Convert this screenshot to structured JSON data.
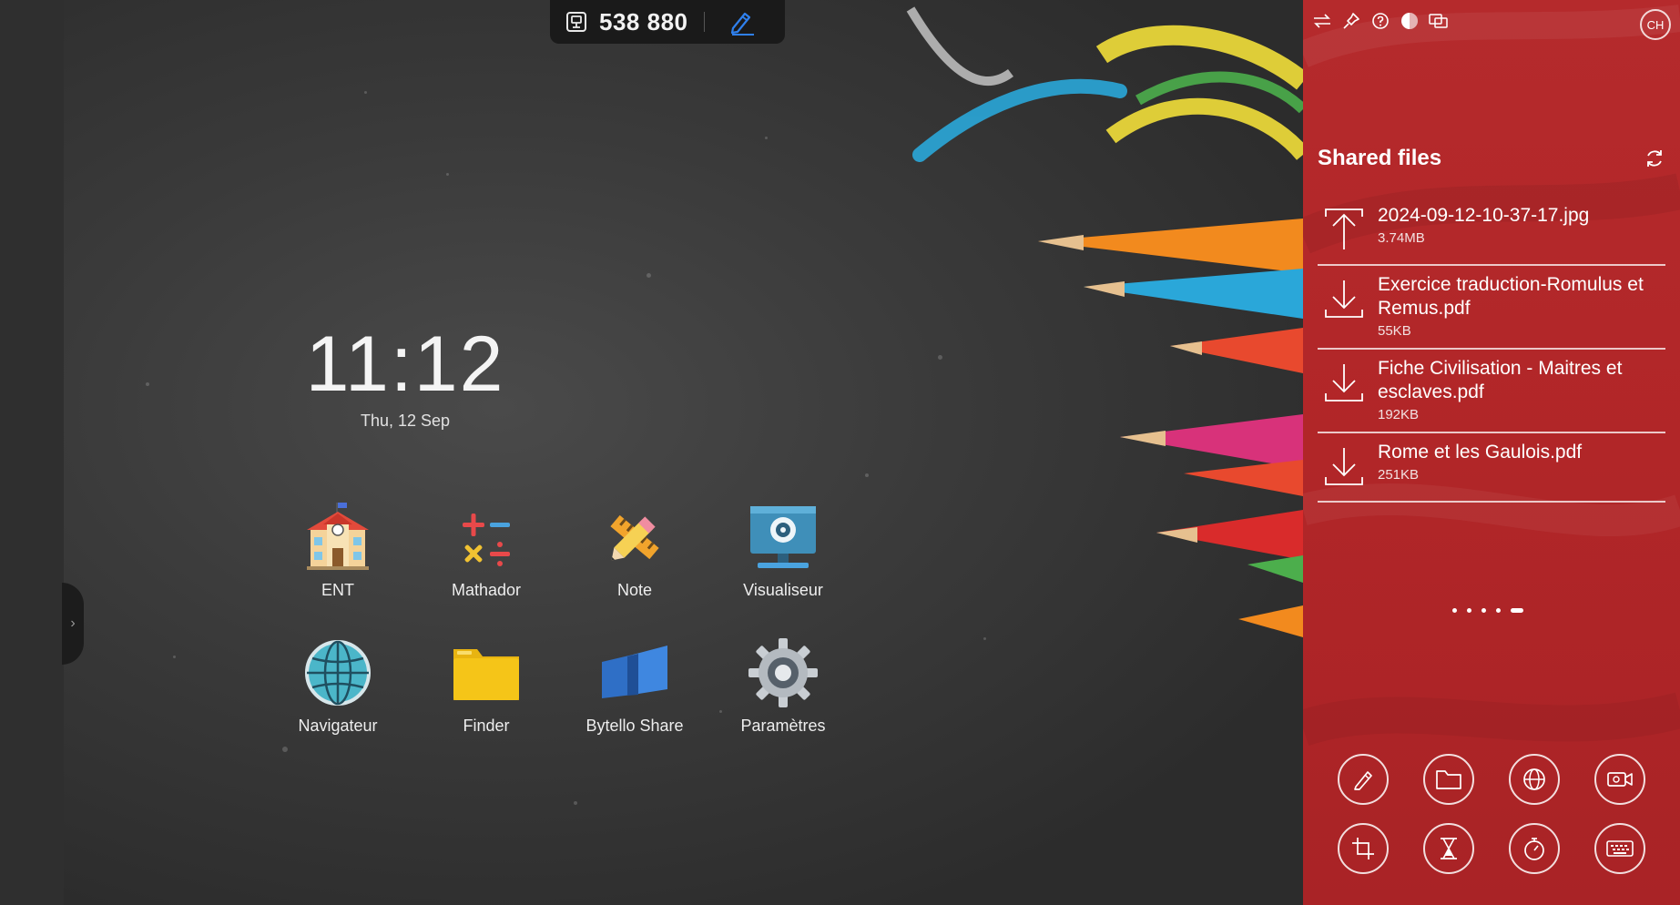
{
  "meeting": {
    "code": "538 880"
  },
  "clock": {
    "time": "11:12",
    "date": "Thu, 12 Sep"
  },
  "apps": [
    {
      "label": "ENT",
      "icon": "school-building-icon"
    },
    {
      "label": "Mathador",
      "icon": "math-symbols-icon"
    },
    {
      "label": "Note",
      "icon": "pencil-ruler-icon"
    },
    {
      "label": "Visualiseur",
      "icon": "document-camera-icon"
    },
    {
      "label": "Navigateur",
      "icon": "globe-icon"
    },
    {
      "label": "Finder",
      "icon": "folder-icon"
    },
    {
      "label": "Bytello Share",
      "icon": "share-book-icon"
    },
    {
      "label": "Paramètres",
      "icon": "gear-icon"
    }
  ],
  "panel": {
    "title": "Shared files",
    "avatar": "CH",
    "files": [
      {
        "name": "2024-09-12-10-37-17.jpg",
        "size": "3.74MB",
        "direction": "upload"
      },
      {
        "name": "Exercice traduction-Romulus et Remus.pdf",
        "size": "55KB",
        "direction": "download"
      },
      {
        "name": "Fiche Civilisation - Maitres et esclaves.pdf",
        "size": "192KB",
        "direction": "download"
      },
      {
        "name": "Rome et les Gaulois.pdf",
        "size": "251KB",
        "direction": "download"
      }
    ],
    "pager": {
      "pages": 5,
      "active": 5
    },
    "top_icons": [
      "swap-icon",
      "pin-icon",
      "help-icon",
      "theme-toggle-icon",
      "screen-share-icon"
    ],
    "tools": [
      "pen-tool-icon",
      "folder-tool-icon",
      "browser-tool-icon",
      "camera-tool-icon",
      "crop-tool-icon",
      "hourglass-tool-icon",
      "stopwatch-tool-icon",
      "keyboard-tool-icon"
    ]
  },
  "colors": {
    "panel_red": "#b12628",
    "code_bar": "#1a1a1a",
    "pencil_accent": "#2f80ed"
  }
}
